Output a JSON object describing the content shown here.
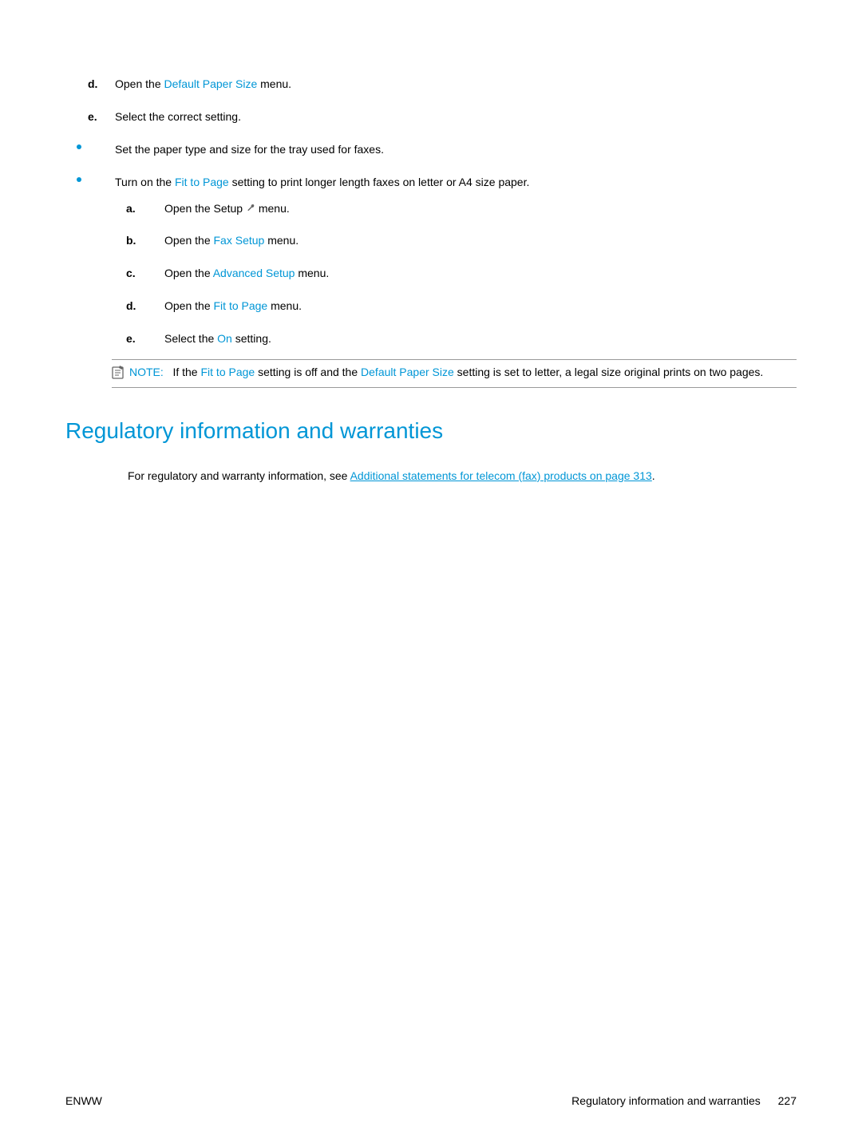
{
  "top_steps": {
    "d": {
      "prefix": "Open the ",
      "term": "Default Paper Size",
      "suffix": " menu."
    },
    "e": {
      "text": "Select the correct setting."
    }
  },
  "bullets": [
    {
      "text": "Set the paper type and size for the tray used for faxes."
    },
    {
      "prefix": "Turn on the ",
      "term": "Fit to Page",
      "suffix": " setting to print longer length faxes on letter or A4 size paper."
    }
  ],
  "subletters": {
    "a": {
      "prefix": "Open the Setup ",
      "suffix": " menu."
    },
    "b": {
      "prefix": "Open the ",
      "term": "Fax Setup",
      "suffix": " menu."
    },
    "c": {
      "prefix": "Open the ",
      "term": "Advanced Setup",
      "suffix": " menu."
    },
    "d": {
      "prefix": "Open the ",
      "term": "Fit to Page",
      "suffix": " menu."
    },
    "e": {
      "prefix": "Select the ",
      "term": "On",
      "suffix": " setting."
    }
  },
  "note": {
    "label": "NOTE:",
    "p1": "If the ",
    "t1": "Fit to Page",
    "p2": " setting is off and the ",
    "t2": "Default Paper Size",
    "p3": " setting is set to letter, a legal size original prints on two pages."
  },
  "heading": "Regulatory information and warranties",
  "reg_para": {
    "prefix": "For regulatory and warranty information, see ",
    "link": "Additional statements for telecom (fax) products on page 313",
    "suffix": "."
  },
  "footer": {
    "left": "ENWW",
    "right_text": "Regulatory information and warranties",
    "page": "227"
  }
}
